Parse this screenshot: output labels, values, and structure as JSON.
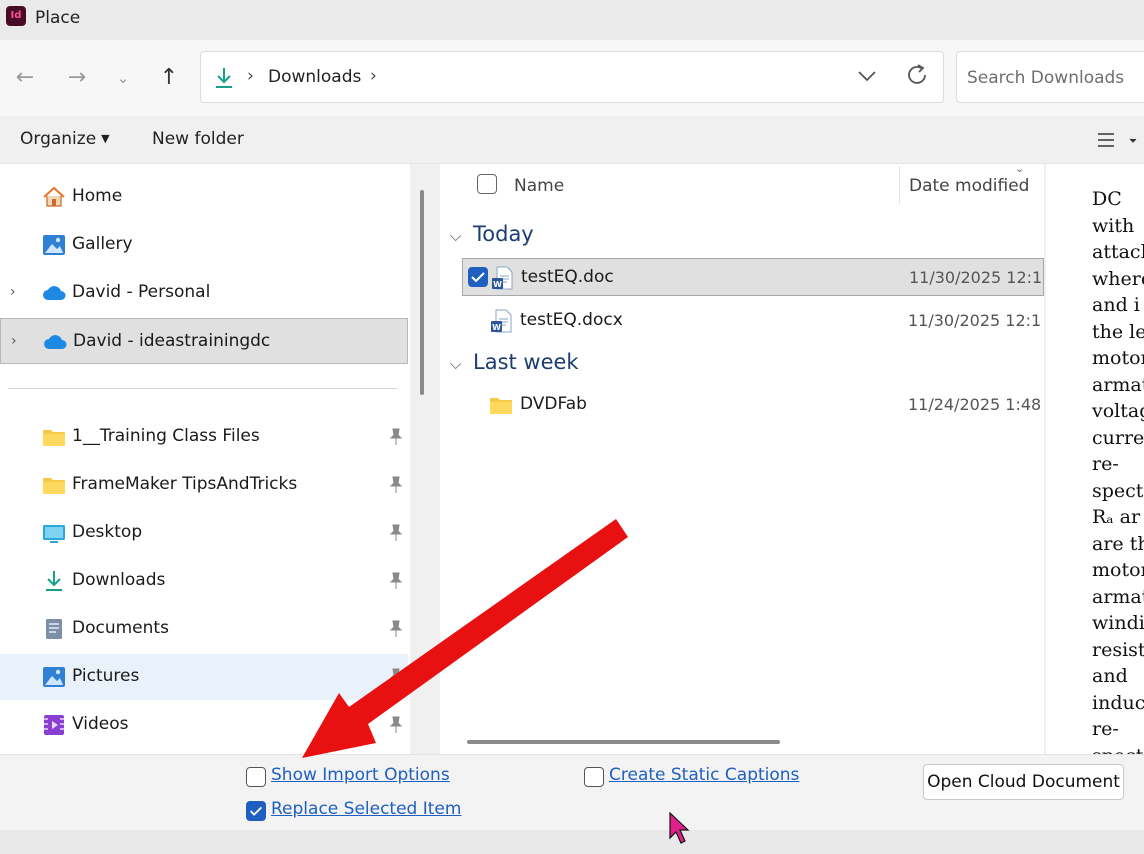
{
  "app": {
    "icon_text": "Id",
    "window_title": "Place"
  },
  "address_bar": {
    "path": "Downloads",
    "search_placeholder": "Search Downloads"
  },
  "toolbar": {
    "organize_label": "Organize",
    "new_folder_label": "New folder"
  },
  "nav_pane": {
    "quick": [
      {
        "label": "Home",
        "icon": "home-icon"
      },
      {
        "label": "Gallery",
        "icon": "gallery-icon"
      },
      {
        "label": "David - Personal",
        "icon": "onedrive-icon"
      },
      {
        "label": "David - ideastrainingdc",
        "icon": "onedrive-icon",
        "selected": true
      }
    ],
    "pinned": [
      {
        "label": "1__Training Class Files",
        "icon": "folder-icon"
      },
      {
        "label": "FrameMaker TipsAndTricks",
        "icon": "folder-icon"
      },
      {
        "label": "Desktop",
        "icon": "desktop-icon"
      },
      {
        "label": "Downloads",
        "icon": "download-icon"
      },
      {
        "label": "Documents",
        "icon": "documents-icon"
      },
      {
        "label": "Pictures",
        "icon": "pictures-icon",
        "hovered": true
      },
      {
        "label": "Videos",
        "icon": "videos-icon"
      }
    ]
  },
  "file_list": {
    "columns": {
      "name": "Name",
      "date": "Date modified"
    },
    "groups": [
      {
        "label": "Today",
        "files": [
          {
            "name": "testEQ.doc",
            "date": "11/30/2025 12:1",
            "icon": "word-doc-icon",
            "selected": true
          },
          {
            "name": "testEQ.docx",
            "date": "11/30/2025 12:1",
            "icon": "word-doc-icon"
          }
        ]
      },
      {
        "label": "Last week",
        "files": [
          {
            "name": "DVDFab",
            "date": "11/24/2025 1:48",
            "icon": "folder-icon"
          }
        ]
      }
    ]
  },
  "preview": {
    "lines": [
      "DC",
      "with",
      "attach",
      "where",
      "and  i",
      "the  le",
      "motor",
      "armatu",
      "voltag",
      "curren",
      "re-",
      "specti",
      "Rₐ  ar",
      "are  th",
      "motor",
      "armatu",
      "windin",
      "resista",
      "and",
      "induct",
      "re-",
      "specti"
    ]
  },
  "options": {
    "show_import_options": {
      "label": "Show Import Options",
      "checked": false
    },
    "replace_selected_item": {
      "label": "Replace Selected Item",
      "checked": true
    },
    "create_static_captions": {
      "label": "Create Static Captions",
      "checked": false
    },
    "open_cloud_document_label": "Open Cloud Document"
  },
  "colors": {
    "accent": "#1f5fbf",
    "group_header": "#1c3d72",
    "annotation_arrow": "#e81010"
  }
}
